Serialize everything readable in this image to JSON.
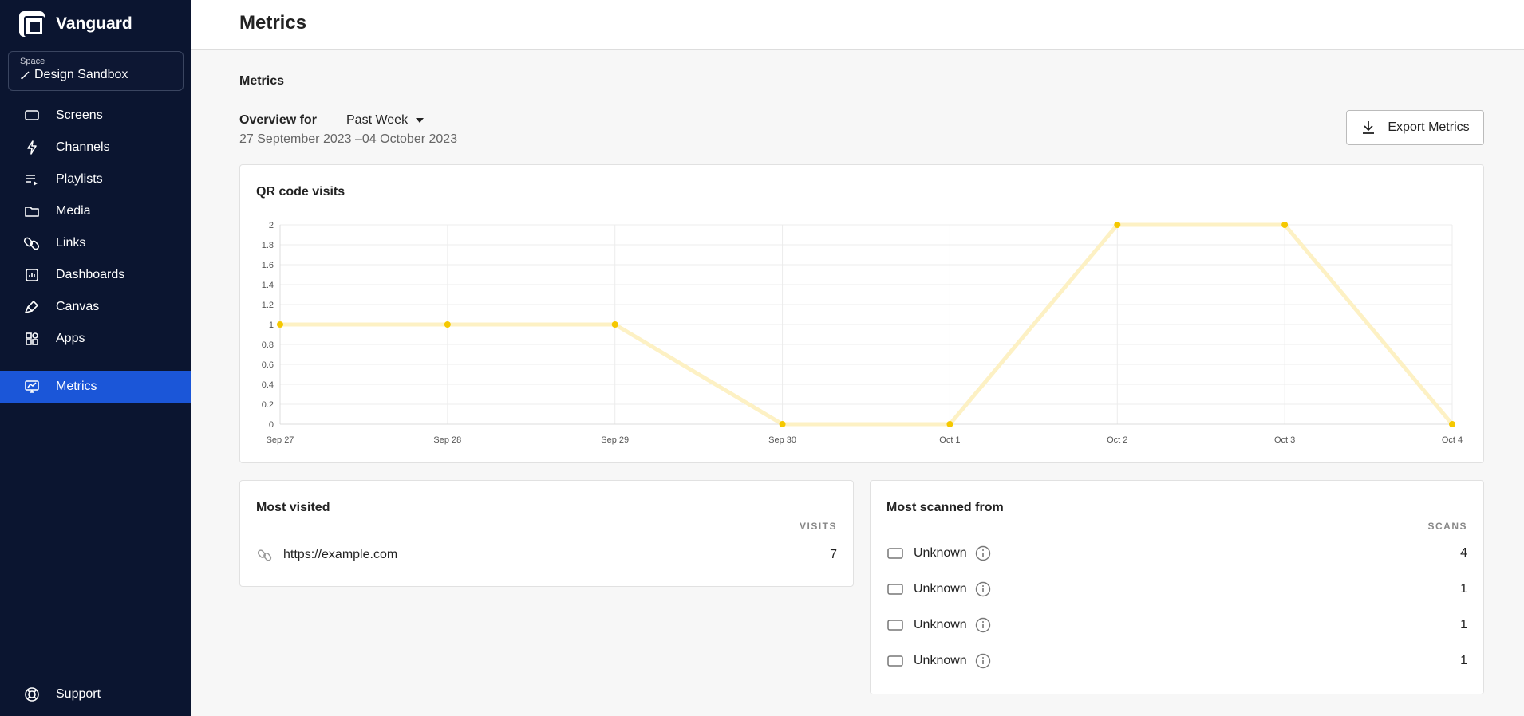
{
  "brand": {
    "name": "Vanguard"
  },
  "space": {
    "label": "Space",
    "value": "Design Sandbox"
  },
  "nav": {
    "items": [
      {
        "label": "Screens",
        "icon": "screen-icon"
      },
      {
        "label": "Channels",
        "icon": "lightning-icon"
      },
      {
        "label": "Playlists",
        "icon": "playlist-icon"
      },
      {
        "label": "Media",
        "icon": "folder-icon"
      },
      {
        "label": "Links",
        "icon": "link-icon"
      },
      {
        "label": "Dashboards",
        "icon": "dashboard-icon"
      },
      {
        "label": "Canvas",
        "icon": "brush-icon"
      },
      {
        "label": "Apps",
        "icon": "apps-icon"
      }
    ],
    "active": {
      "label": "Metrics",
      "icon": "metrics-icon"
    },
    "support": {
      "label": "Support",
      "icon": "lifebuoy-icon"
    }
  },
  "header": {
    "title": "Metrics"
  },
  "main": {
    "section_title": "Metrics",
    "overview_label": "Overview for",
    "range_value": "Past Week",
    "date_range": "27 September 2023 –04 October 2023",
    "export_label": "Export Metrics"
  },
  "colors": {
    "accent": "#1b56d8",
    "sidebar": "#0b1530",
    "series_point": "#f5c800",
    "series_line": "#fdf1c4"
  },
  "chart_data": {
    "type": "line",
    "title": "QR code visits",
    "categories": [
      "Sep 27",
      "Sep 28",
      "Sep 29",
      "Sep 30",
      "Oct 1",
      "Oct 2",
      "Oct 3",
      "Oct 4"
    ],
    "values": [
      1,
      1,
      1,
      0,
      0,
      2,
      2,
      0
    ],
    "ylim": [
      0,
      2
    ],
    "yticks": [
      "0",
      "0.2",
      "0.4",
      "0.6",
      "0.8",
      "1",
      "1.2",
      "1.4",
      "1.6",
      "1.8",
      "2"
    ],
    "grid": true
  },
  "most_visited": {
    "title": "Most visited",
    "column_header": "VISITS",
    "rows": [
      {
        "label": "https://example.com",
        "value": "7",
        "icon": "link-icon"
      }
    ]
  },
  "most_scanned": {
    "title": "Most scanned from",
    "column_header": "SCANS",
    "rows": [
      {
        "label": "Unknown",
        "value": "4",
        "icon": "screen-icon"
      },
      {
        "label": "Unknown",
        "value": "1",
        "icon": "screen-icon"
      },
      {
        "label": "Unknown",
        "value": "1",
        "icon": "screen-icon"
      },
      {
        "label": "Unknown",
        "value": "1",
        "icon": "screen-icon"
      }
    ]
  }
}
